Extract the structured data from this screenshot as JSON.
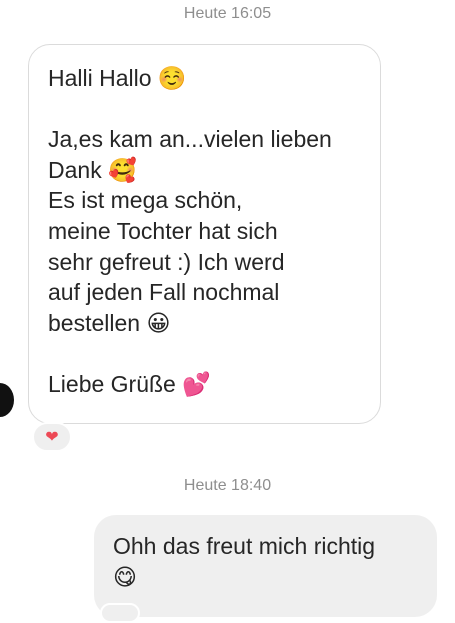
{
  "timestamps": {
    "first": "Heute 16:05",
    "second": "Heute 18:40"
  },
  "incoming": {
    "text": "Halli Hallo ☺️\n\nJa,es kam an...vielen lieben\nDank 🥰\nEs ist mega schön,\nmeine Tochter hat sich\nsehr gefreut :) Ich werd\nauf jeden Fall nochmal\nbestellen 😀\n\nLiebe Grüße 💕",
    "reaction": "❤"
  },
  "outgoing": {
    "text": "Ohh das freut mich richtig\n😋"
  },
  "colors": {
    "incoming_bubble_border": "#dbdbdb",
    "outgoing_bubble_bg": "#efefef",
    "timestamp": "#8e8e8e",
    "text": "#262626",
    "reaction_heart": "#ed4956"
  },
  "icons": {
    "reaction": "heart-icon",
    "avatar": "avatar"
  }
}
